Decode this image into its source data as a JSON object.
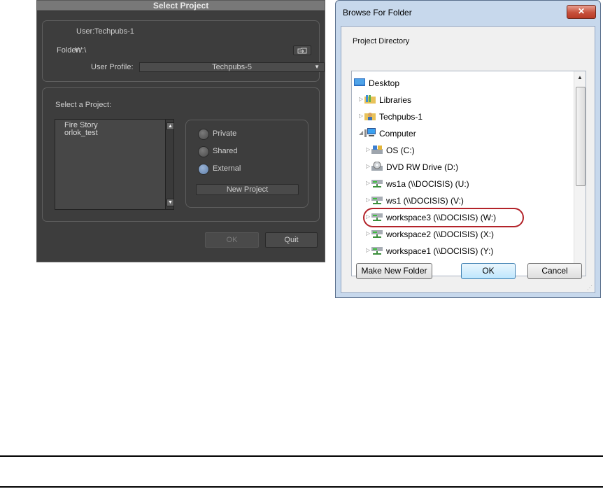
{
  "select_project": {
    "title": "Select Project",
    "user_label": "User:",
    "user_value": "Techpubs-1",
    "folder_label": "Folder:",
    "folder_value": "W:\\",
    "folder_button_icon": "folder-browse-icon",
    "profile_label": "User Profile:",
    "profile_value": "Techpubs-5",
    "select_label": "Select a Project:",
    "projects": [
      "Fire Story",
      "orlok_test"
    ],
    "radios": [
      {
        "label": "Private",
        "selected": false
      },
      {
        "label": "Shared",
        "selected": false
      },
      {
        "label": "External",
        "selected": true
      }
    ],
    "new_project_label": "New Project",
    "ok_label": "OK",
    "quit_label": "Quit"
  },
  "browse_folder": {
    "title": "Browse For Folder",
    "close_glyph": "✕",
    "heading": "Project Directory",
    "tree": [
      {
        "label": "Desktop",
        "icon": "desktop-icon",
        "level": 0,
        "expander": ""
      },
      {
        "label": "Libraries",
        "icon": "libraries-icon",
        "level": 1,
        "expander": "▷"
      },
      {
        "label": "Techpubs-1",
        "icon": "user-folder-icon",
        "level": 1,
        "expander": "▷"
      },
      {
        "label": "Computer",
        "icon": "computer-icon",
        "level": 1,
        "expander": "◢"
      },
      {
        "label": "OS (C:)",
        "icon": "hard-drive-icon",
        "level": 2,
        "expander": "▷"
      },
      {
        "label": "DVD RW Drive (D:)",
        "icon": "dvd-drive-icon",
        "level": 2,
        "expander": "▷"
      },
      {
        "label": "ws1a (\\\\DOCISIS) (U:)",
        "icon": "network-drive-icon",
        "level": 2,
        "expander": "▷"
      },
      {
        "label": "ws1 (\\\\DOCISIS) (V:)",
        "icon": "network-drive-icon",
        "level": 2,
        "expander": "▷"
      },
      {
        "label": "workspace3 (\\\\DOCISIS) (W:)",
        "icon": "network-drive-icon",
        "level": 2,
        "expander": "▷",
        "highlighted": true
      },
      {
        "label": "workspace2 (\\\\DOCISIS) (X:)",
        "icon": "network-drive-icon",
        "level": 2,
        "expander": "▷"
      },
      {
        "label": "workspace1 (\\\\DOCISIS) (Y:)",
        "icon": "network-drive-icon",
        "level": 2,
        "expander": "▷"
      }
    ],
    "make_new_folder_label": "Make New Folder",
    "ok_label": "OK",
    "cancel_label": "Cancel"
  },
  "colors": {
    "highlight_ring": "#b3232a",
    "dark_dialog_bg": "#3d3d3d",
    "win_frame": "#c7d8ec"
  }
}
